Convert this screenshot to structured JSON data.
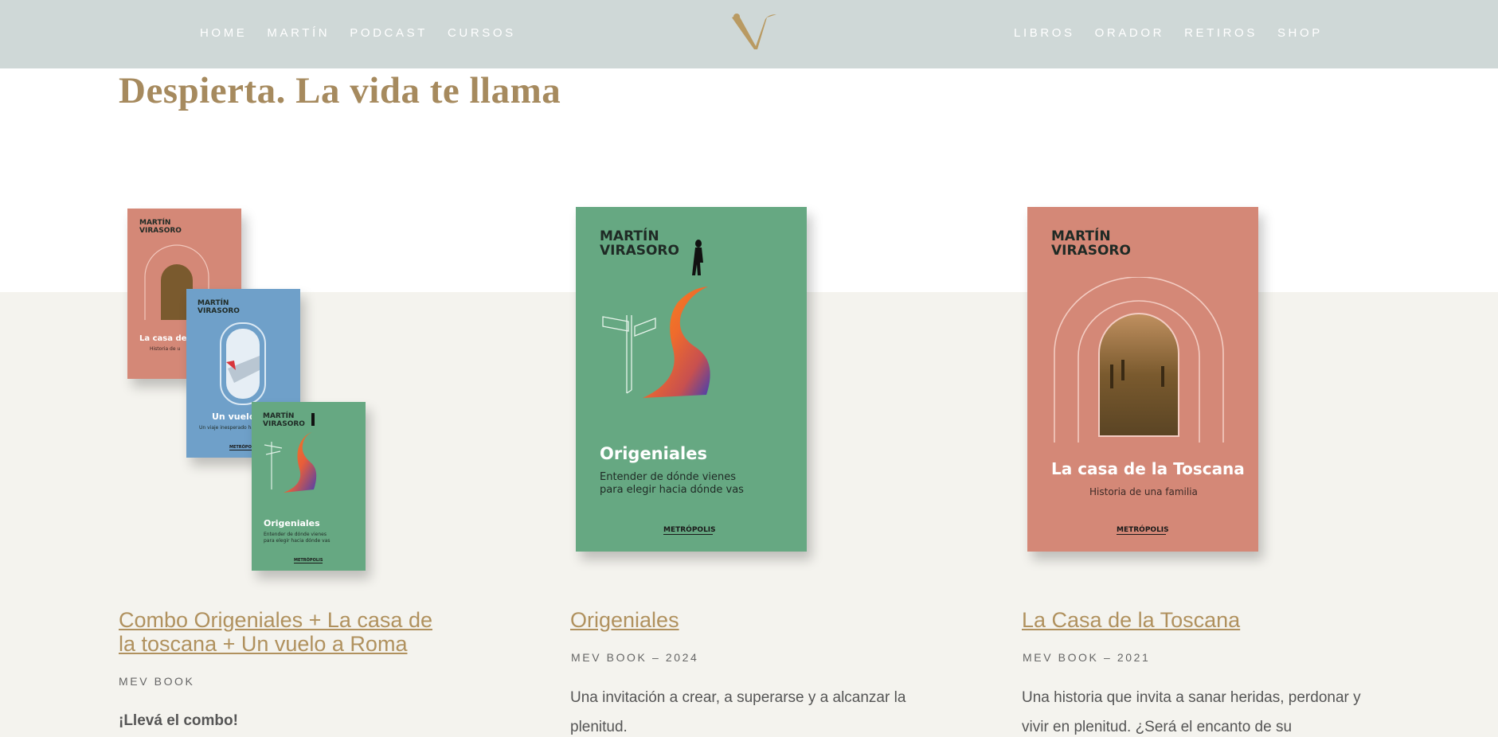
{
  "header": {
    "nav_left": [
      "HOME",
      "MARTÍN",
      "PODCAST",
      "CURSOS"
    ],
    "nav_right": [
      "LIBROS",
      "ORADOR",
      "RETIROS",
      "SHOP"
    ],
    "logo_letter": "V"
  },
  "page": {
    "title": "Despierta. La vida te llama"
  },
  "books": {
    "origeniales": {
      "author_line1": "MARTÍN",
      "author_line2": "VIRASORO",
      "title": "Origeniales",
      "subtitle_line1": "Entender de dónde vienes",
      "subtitle_line2": "para elegir hacia dónde vas",
      "publisher": "METRÓPOLIS"
    },
    "toscana": {
      "author_line1": "MARTÍN",
      "author_line2": "VIRASORO",
      "title": "La casa de la Toscana",
      "subtitle": "Historia de una familia",
      "publisher": "METRÓPOLIS"
    },
    "vuelo": {
      "author_line1": "MARTÍN",
      "author_line2": "VIRASORO",
      "title_visible": "Un vuelo a",
      "subtitle_visible": "Un viaje inesperado ha",
      "publisher": "METRÓPOLIS"
    },
    "toscana_small": {
      "title_visible": "La casa de l",
      "subtitle_visible": "Historia de u"
    }
  },
  "products": [
    {
      "title_line1": "Combo Origeniales + La casa de",
      "title_line2": "la toscana + Un vuelo a Roma",
      "meta": "MEV BOOK",
      "cta": "¡Llevá el combo!"
    },
    {
      "title": "Origeniales",
      "meta": "MEV BOOK – 2024",
      "desc_line1": "Una invitación a crear, a superarse y a alcanzar la",
      "desc_line2": "plenitud."
    },
    {
      "title": "La Casa de la Toscana",
      "meta": "MEV BOOK – 2021",
      "desc_line1": "Una historia que invita a sanar heridas, perdonar y",
      "desc_line2": "vivir en plenitud. ¿Será el encanto de su"
    }
  ],
  "colors": {
    "header_bg": "#cfd8d7",
    "band_bg": "#f4f3ee",
    "gold": "#b0915e",
    "green_cover": "#66a882",
    "pink_cover": "#d48877",
    "blue_cover": "#6fa0c9"
  }
}
